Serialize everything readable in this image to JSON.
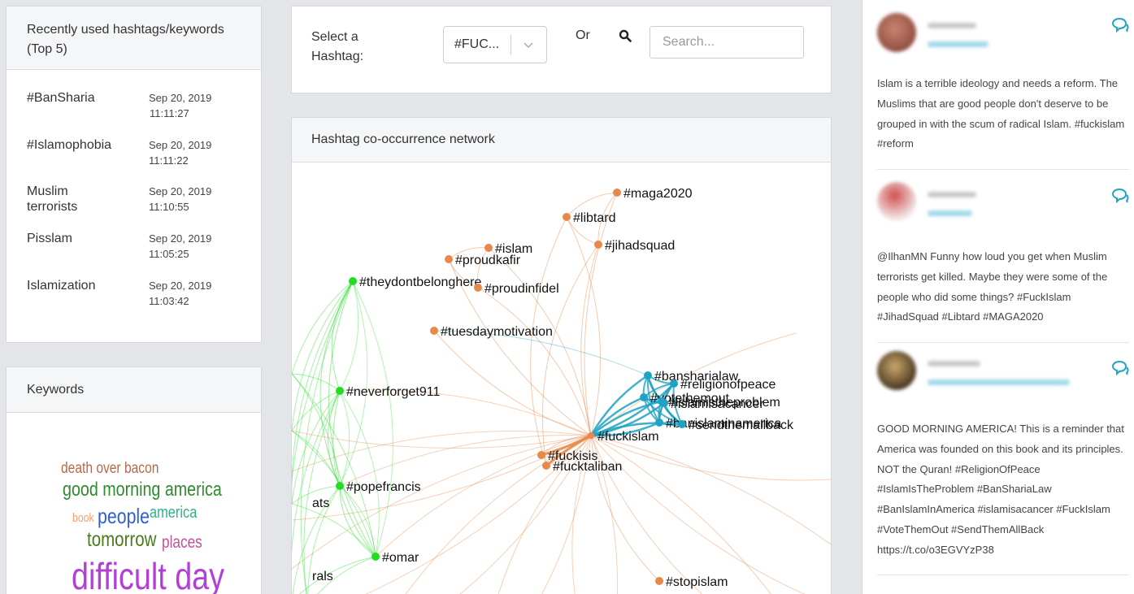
{
  "recent": {
    "title": "Recently used hashtags/keywords (Top 5)",
    "items": [
      {
        "tag": "#BanSharia",
        "date": "Sep 20, 2019",
        "time": "11:11:27"
      },
      {
        "tag": "#Islamophobia",
        "date": "Sep 20, 2019",
        "time": "11:11:22"
      },
      {
        "tag": "Muslim terrorists",
        "date": "Sep 20, 2019",
        "time": "11:10:55"
      },
      {
        "tag": "Pisslam",
        "date": "Sep 20, 2019",
        "time": "11:05:25"
      },
      {
        "tag": "Islamization",
        "date": "Sep 20, 2019",
        "time": "11:03:42"
      }
    ]
  },
  "keywords": {
    "title": "Keywords",
    "words": [
      {
        "text": "death over bacon",
        "color": "#b9674a"
      },
      {
        "text": "good morning america",
        "color": "#2e8b2e"
      },
      {
        "text": "book",
        "color": "#f0a070"
      },
      {
        "text": "people",
        "color": "#2f5fd8"
      },
      {
        "text": "america",
        "color": "#2fb28a"
      },
      {
        "text": "tomorrow",
        "color": "#4a7a1c"
      },
      {
        "text": "places",
        "color": "#c2509a"
      },
      {
        "text": "difficult day",
        "color": "#b23fd6"
      }
    ]
  },
  "selector": {
    "label": "Select a Hashtag:",
    "selected": "#FUC...",
    "or_label": "Or",
    "search_placeholder": "Search..."
  },
  "network": {
    "title": "Hashtag co-occurrence network",
    "colors": {
      "orange": "#e8894c",
      "green": "#22dd22",
      "blue": "#1fa3c4"
    },
    "nodes": [
      {
        "label": "#maga2020",
        "group": "orange"
      },
      {
        "label": "#libtard",
        "group": "orange"
      },
      {
        "label": "#jihadsquad",
        "group": "orange"
      },
      {
        "label": "#islam",
        "group": "orange"
      },
      {
        "label": "#proudkafir",
        "group": "orange"
      },
      {
        "label": "#theydontbelonghere",
        "group": "green"
      },
      {
        "label": "#proudinfidel",
        "group": "orange"
      },
      {
        "label": "#tuesdaymotivation",
        "group": "orange"
      },
      {
        "label": "#neverforget911",
        "group": "green"
      },
      {
        "label": "#bansharialaw",
        "group": "blue"
      },
      {
        "label": "#religionofpeace",
        "group": "blue"
      },
      {
        "label": "#votethemout",
        "group": "blue"
      },
      {
        "label": "#islamisacancer",
        "group": "blue"
      },
      {
        "label": "#islamistheproblem",
        "group": "blue"
      },
      {
        "label": "#banislaminamerica",
        "group": "blue"
      },
      {
        "label": "#sendthemallback",
        "group": "blue"
      },
      {
        "label": "#fuckislam",
        "group": "orange"
      },
      {
        "label": "#fuckisis",
        "group": "orange"
      },
      {
        "label": "#fucktaliban",
        "group": "orange"
      },
      {
        "label": "#popefrancis",
        "group": "green"
      },
      {
        "label": "ats",
        "group": "green"
      },
      {
        "label": "#omar",
        "group": "green"
      },
      {
        "label": "rals",
        "group": "green"
      },
      {
        "label": "#stopislam",
        "group": "orange"
      }
    ]
  },
  "tweets": [
    {
      "text": "Islam is a terrible ideology and needs a reform. The Muslims that are good people don't deserve to be grouped in with the scum of radical Islam. #fuckislam #reform"
    },
    {
      "text": "@IlhanMN Funny how loud you get when Muslim terrorists get killed. Maybe they were some of the people who did some things? #FuckIslam #JihadSquad #Libtard #MAGA2020"
    },
    {
      "text": "GOOD MORNING AMERICA! This is a reminder that America was founded on this book and its principles. NOT the Quran! #ReligionOfPeace #IslamIsTheProblem #BanShariaLaw #BanIslamInAmerica #islamisacancer #FuckIslam #VoteThemOut #SendThemAllBack https://t.co/o3EGVYzP38"
    }
  ]
}
